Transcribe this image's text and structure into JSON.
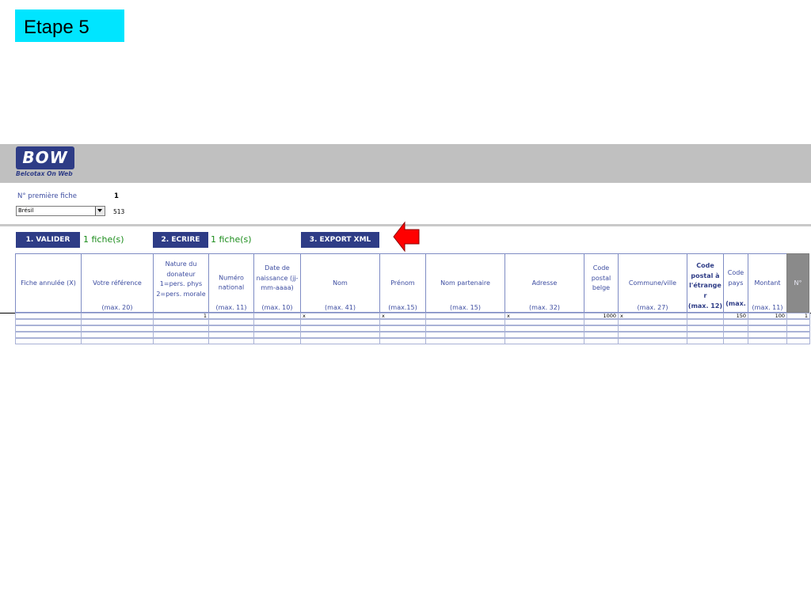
{
  "step": {
    "label": "Etape 5"
  },
  "banner": {
    "logo_text": "BOW",
    "logo_subtitle": "Belcotax On Web"
  },
  "form": {
    "first_sheet_label": "N° première fiche",
    "first_sheet_value": "1",
    "country_selected": "Brésil",
    "country_code": "513"
  },
  "actions": {
    "validate_label": "1. VALIDER",
    "validate_count": "1 fiche(s)",
    "write_label": "2. ECRIRE",
    "write_count": "1 fiche(s)",
    "export_label": "3. EXPORT XML"
  },
  "table": {
    "headers": [
      {
        "label": "Fiche annulée (X)",
        "max": ""
      },
      {
        "label": "Votre référence",
        "max": "(max. 20)"
      },
      {
        "label": "Nature du donateur 1=pers. phys 2=pers. morale",
        "max": ""
      },
      {
        "label": "Numéro national",
        "max": "(max. 11)"
      },
      {
        "label": "Date de naissance (jj-mm-aaaa)",
        "max": "(max. 10)"
      },
      {
        "label": "Nom",
        "max": "(max. 41)"
      },
      {
        "label": "Prénom",
        "max": "(max.15)"
      },
      {
        "label": "Nom partenaire",
        "max": "(max. 15)"
      },
      {
        "label": "Adresse",
        "max": "(max. 32)"
      },
      {
        "label": "Code postal belge",
        "max": ""
      },
      {
        "label": "Commune/ville",
        "max": "(max. 27)"
      },
      {
        "label": "Code postal à l'étrange r",
        "max": "(max. 12)"
      },
      {
        "label": "Code pays",
        "max": "(max."
      },
      {
        "label": "Montant",
        "max": "(max. 11)"
      },
      {
        "label": "N°",
        "max": ""
      }
    ],
    "row1": {
      "nature": "1",
      "nom": "x",
      "prenom": "x",
      "adresse": "x",
      "code_postal": "1000",
      "commune": "x",
      "code_pays": "150",
      "montant": "100",
      "numero": "1"
    }
  },
  "colors": {
    "accent_blue": "#2e3c86",
    "header_text": "#3c4ca0",
    "count_green": "#1b8c1b",
    "step_cyan": "#00e5ff",
    "arrow_red": "#ff0000"
  }
}
